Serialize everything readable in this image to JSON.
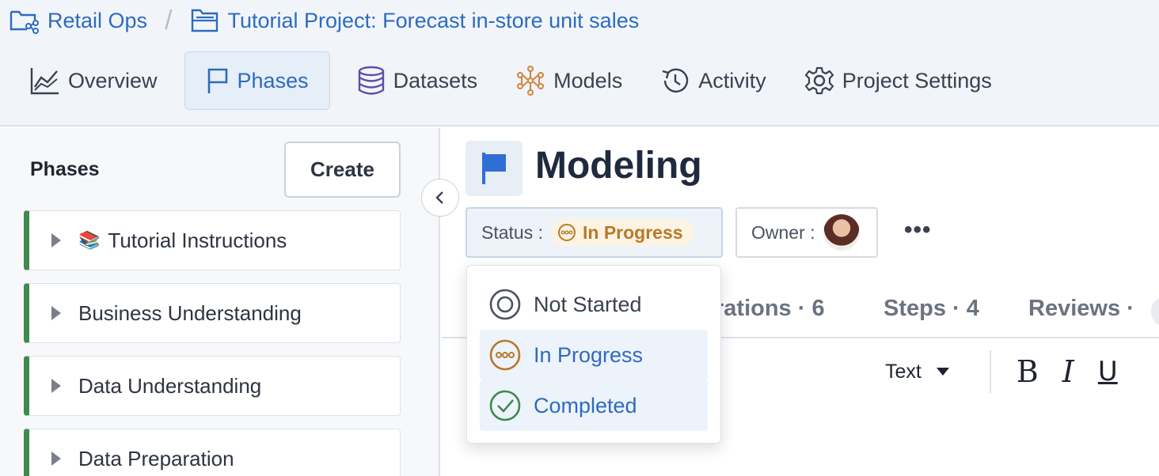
{
  "breadcrumb": {
    "workspace": "Retail Ops",
    "separator": "/",
    "project": "Tutorial Project: Forecast in-store unit sales"
  },
  "tabs": [
    {
      "label": "Overview",
      "icon": "line-chart-icon"
    },
    {
      "label": "Phases",
      "icon": "flag-icon",
      "active": true
    },
    {
      "label": "Datasets",
      "icon": "database-icon"
    },
    {
      "label": "Models",
      "icon": "network-icon"
    },
    {
      "label": "Activity",
      "icon": "history-icon"
    },
    {
      "label": "Project Settings",
      "icon": "gear-icon"
    }
  ],
  "sidebar": {
    "title": "Phases",
    "create_label": "Create",
    "items": [
      {
        "label": "Tutorial Instructions",
        "emoji": "📚"
      },
      {
        "label": "Business Understanding"
      },
      {
        "label": "Data Understanding"
      },
      {
        "label": "Data Preparation"
      }
    ]
  },
  "phase": {
    "title": "Modeling",
    "status_label": "Status :",
    "status_value": "In Progress",
    "owner_label": "Owner :",
    "more_label": "•••"
  },
  "subtabs": {
    "iterations": "rations · 6",
    "steps": "Steps · 4",
    "reviews": "Reviews ·"
  },
  "editor": {
    "text_style": "Text",
    "bold": "B",
    "italic": "I",
    "underline": "U"
  },
  "status_dropdown": {
    "options": [
      {
        "label": "Not Started",
        "icon": "not-started-icon"
      },
      {
        "label": "In Progress",
        "icon": "in-progress-icon"
      },
      {
        "label": "Completed",
        "icon": "completed-icon"
      }
    ]
  },
  "colors": {
    "accent": "#2d6bbf",
    "phase_border": "#3f8a4d",
    "in_progress": "#b8792a",
    "completed": "#3f8a4d",
    "flag": "#2f6fd4"
  }
}
